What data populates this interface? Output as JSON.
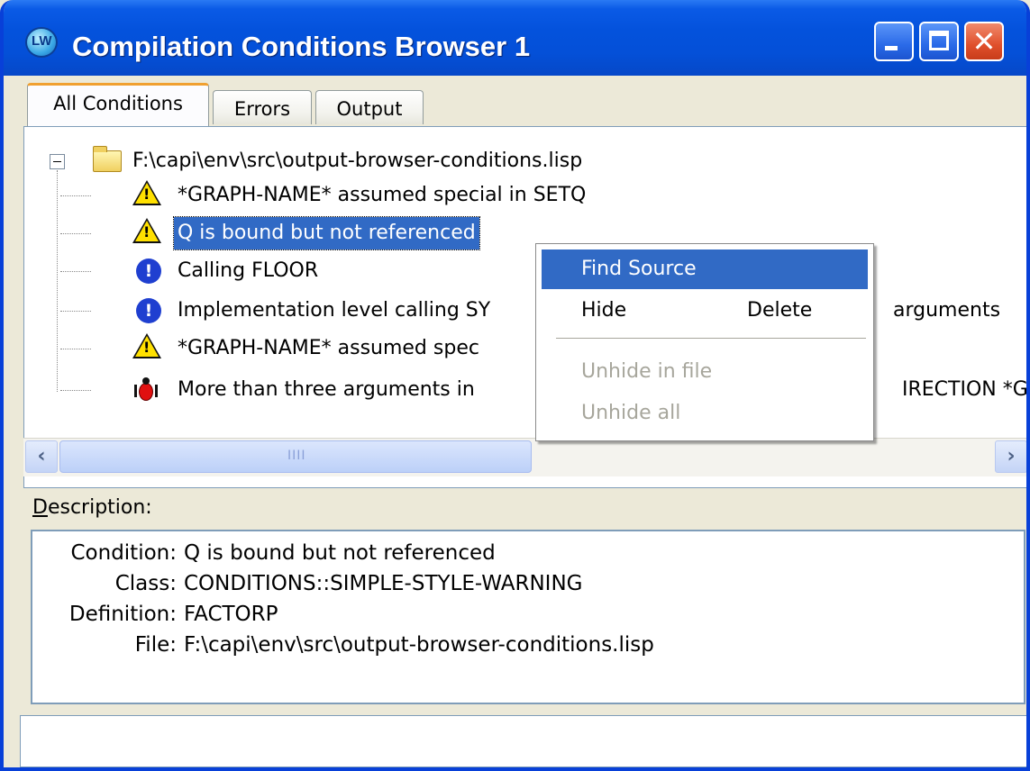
{
  "window": {
    "title": "Compilation Conditions Browser 1",
    "icon_label": "LW"
  },
  "tabs": [
    {
      "label": "All Conditions",
      "active": true
    },
    {
      "label": "Errors",
      "active": false
    },
    {
      "label": "Output",
      "active": false
    }
  ],
  "tree": {
    "root": {
      "label": "F:\\capi\\env\\src\\output-browser-conditions.lisp",
      "icon": "folder-icon"
    },
    "items": [
      {
        "label": "*GRAPH-NAME* assumed special in SETQ",
        "icon": "warning-icon"
      },
      {
        "label": "Q is bound but not referenced",
        "icon": "warning-icon",
        "selected": true
      },
      {
        "label": "Calling  FLOOR",
        "icon": "info-icon"
      },
      {
        "label": "Implementation level calling  SY",
        "suffix": "arguments",
        "icon": "info-icon"
      },
      {
        "label": "*GRAPH-NAME* assumed spec",
        "icon": "warning-icon"
      },
      {
        "label": "More than three arguments in",
        "suffix": "IRECTION *G",
        "icon": "bug-icon"
      }
    ]
  },
  "context_menu": {
    "items": [
      {
        "label": "Find Source",
        "highlighted": true
      },
      {
        "label": "Hide",
        "right_label": "Delete"
      },
      {
        "label": "Unhide in file",
        "disabled": true
      },
      {
        "label": "Unhide all",
        "disabled": true
      }
    ]
  },
  "description": {
    "label_prefix": "D",
    "label_rest": "escription:",
    "rows": [
      {
        "key": "Condition:",
        "value": "Q is bound but not referenced"
      },
      {
        "key": "Class:",
        "value": "CONDITIONS::SIMPLE-STYLE-WARNING"
      },
      {
        "key": "Definition:",
        "value": "FACTORP"
      },
      {
        "key": "File:",
        "value": "F:\\capi\\env\\src\\output-browser-conditions.lisp"
      }
    ]
  },
  "colors": {
    "titlebar": "#0452dc",
    "selection": "#316ac5",
    "warning": "#ffe000",
    "info": "#1f3fd0",
    "bug": "#e01010"
  }
}
